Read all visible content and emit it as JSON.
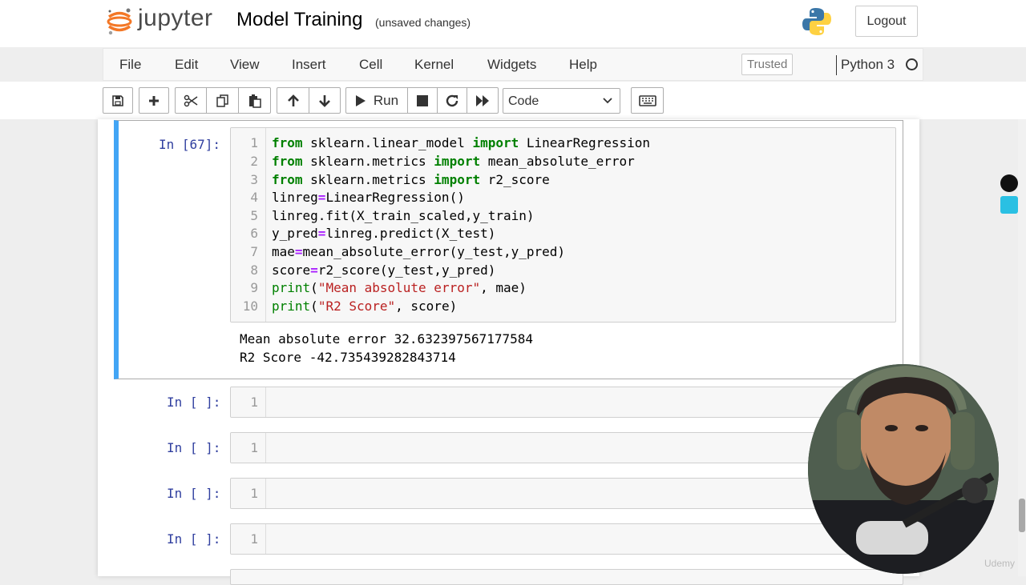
{
  "header": {
    "brand": "jupyter",
    "notebook_title": "Model Training",
    "save_status": "(unsaved changes)",
    "logout_label": "Logout"
  },
  "menubar": {
    "items": [
      "File",
      "Edit",
      "View",
      "Insert",
      "Cell",
      "Kernel",
      "Widgets",
      "Help"
    ],
    "trusted_label": "Trusted",
    "kernel_name": "Python 3"
  },
  "toolbar": {
    "run_label": "Run",
    "cell_type": "Code",
    "icons": [
      "save-icon",
      "plus-icon",
      "cut-icon",
      "copy-icon",
      "paste-icon",
      "arrow-up-icon",
      "arrow-down-icon",
      "play-icon",
      "stop-icon",
      "restart-icon",
      "fast-forward-icon",
      "keyboard-icon"
    ]
  },
  "cells": {
    "active": {
      "prompt": "In [67]:",
      "line_numbers": [
        "1",
        "2",
        "3",
        "4",
        "5",
        "6",
        "7",
        "8",
        "9",
        "10"
      ],
      "code": [
        "from sklearn.linear_model import LinearRegression",
        "from sklearn.metrics import mean_absolute_error",
        "from sklearn.metrics import r2_score",
        "linreg=LinearRegression()",
        "linreg.fit(X_train_scaled,y_train)",
        "y_pred=linreg.predict(X_test)",
        "mae=mean_absolute_error(y_test,y_pred)",
        "score=r2_score(y_test,y_pred)",
        "print(\"Mean absolute error\", mae)",
        "print(\"R2 Score\", score)"
      ],
      "output": [
        "Mean absolute error 32.632397567177584",
        "R2 Score -42.735439282843714"
      ]
    },
    "empty": [
      {
        "prompt": "In [ ]:",
        "line": "1"
      },
      {
        "prompt": "In [ ]:",
        "line": "1"
      },
      {
        "prompt": "In [ ]:",
        "line": "1"
      },
      {
        "prompt": "In [ ]:",
        "line": "1"
      }
    ]
  },
  "watermark": "Udemy",
  "colors": {
    "selected_cell_bar": "#42a5f5",
    "keyword": "#008000",
    "operator": "#aa22ff",
    "string": "#ba2121",
    "prompt": "#303f9f",
    "jupyter_orange": "#f37726"
  }
}
